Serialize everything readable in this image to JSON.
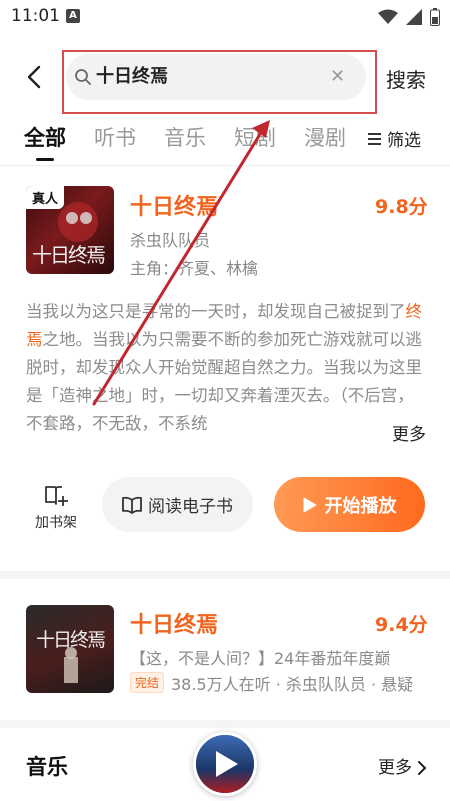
{
  "status": {
    "time": "11:01",
    "a_icon": "A"
  },
  "search": {
    "query": "十日终焉",
    "button": "搜索"
  },
  "tabs": [
    "全部",
    "听书",
    "音乐",
    "短剧",
    "漫剧"
  ],
  "filter_label": "筛选",
  "result1": {
    "badge": "真人",
    "cover_art": "十日终焉",
    "title": "十日终焉",
    "score": "9.8分",
    "author": "杀虫队队员",
    "cast": "主角：齐夏、林檎",
    "desc_pre": "当我以为这只是寻常的一天时，却发现自己被捉到了",
    "desc_hl": "终焉",
    "desc_post": "之地。当我以为只需要不断的参加死亡游戏就可以逃脱时，却发现众人开始觉醒超自然之力。当我以为这里是「造神之地」时，一切却又奔着湮灭去。（不后宫，不套路，不无敌，不系统",
    "more": "更多",
    "shelf": "加书架",
    "ebook": "阅读电子书",
    "play": "开始播放"
  },
  "result2": {
    "cover_art": "十日终焉",
    "title": "十日终焉",
    "score": "9.4分",
    "subtitle": "【这，不是人间？】24年番茄年度巅",
    "badge": "完结",
    "meta": "38.5万人在听 · 杀虫队队员 · 悬疑"
  },
  "music": {
    "title": "音乐",
    "more": "更多"
  },
  "colors": {
    "accent": "#f0641e",
    "annotation": "#c0282d"
  },
  "icons": [
    "back-arrow-icon",
    "search-icon",
    "clear-icon",
    "menu-lines-icon",
    "bookshelf-add-icon",
    "book-open-icon",
    "play-icon",
    "chevron-right-icon"
  ]
}
